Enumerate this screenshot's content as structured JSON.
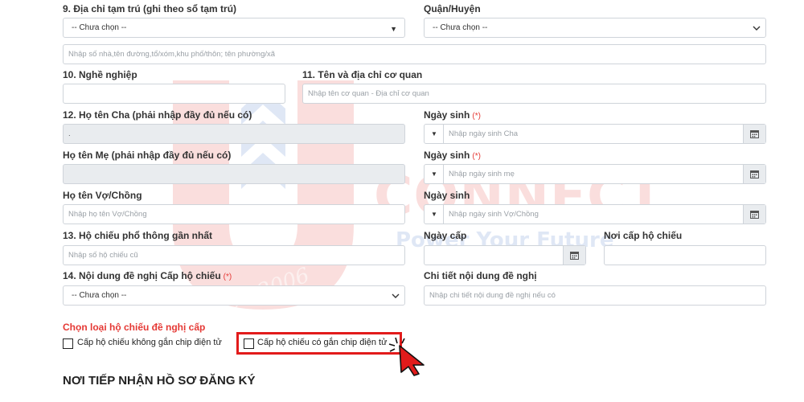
{
  "watermark": {
    "brand": "CONNECT",
    "tagline": "Power Your Future",
    "est": "Est. 2006"
  },
  "colors": {
    "accent": "#e53935",
    "border": "#cfd4da",
    "disabled_bg": "#e9ecef"
  },
  "form": {
    "q9": {
      "label": "9. Địa chỉ tạm trú (ghi theo sổ tạm trú)",
      "province_value": "-- Chưa chọn --",
      "district_label": "Quận/Huyện",
      "district_value": "-- Chưa chọn --",
      "address_placeholder": "Nhập số nhà,tên đường,tổ/xóm,khu phố/thôn; tên phường/xã"
    },
    "q10": {
      "label": "10. Nghề nghiệp"
    },
    "q11": {
      "label": "11. Tên và địa chỉ cơ quan",
      "placeholder": "Nhập tên cơ quan - Địa chỉ cơ quan"
    },
    "q12": {
      "father_label": "12. Họ tên Cha (phải nhập đầy đủ nếu có)",
      "father_value": ".",
      "father_dob_label": "Ngày sinh",
      "father_dob_required": "(*)",
      "father_dob_placeholder": "Nhập ngày sinh Cha",
      "mother_label": "Họ tên Mẹ (phải nhập đầy đủ nếu có)",
      "mother_dob_label": "Ngày sinh",
      "mother_dob_required": "(*)",
      "mother_dob_placeholder": "Nhập ngày sinh mẹ",
      "spouse_label": "Họ tên Vợ/Chồng",
      "spouse_placeholder": "Nhập họ tên Vợ/Chồng",
      "spouse_dob_label": "Ngày sinh",
      "spouse_dob_placeholder": "Nhập ngày sinh Vợ/Chồng"
    },
    "q13": {
      "label": "13. Hộ chiếu phổ thông gần nhất",
      "placeholder": "Nhập số hộ chiếu cũ",
      "issue_date_label": "Ngày cấp",
      "issue_place_label": "Nơi cấp hộ chiếu"
    },
    "q14": {
      "label": "14. Nội dung đề nghị Cấp hộ chiếu",
      "required": "(*)",
      "select_value": "-- Chưa chọn --",
      "detail_label": "Chi tiết nội dung đề nghị",
      "detail_placeholder": "Nhập chi tiết nội dung đề nghị nếu có"
    },
    "passport_type": {
      "title": "Chọn loại hộ chiếu đề nghị cấp",
      "option_no_chip": "Cấp hộ chiếu không gắn chip điện tử",
      "option_chip": "Cấp hộ chiếu có gắn chip điện tử"
    },
    "section_title": "NƠI TIẾP NHẬN HỒ SƠ ĐĂNG KÝ"
  }
}
